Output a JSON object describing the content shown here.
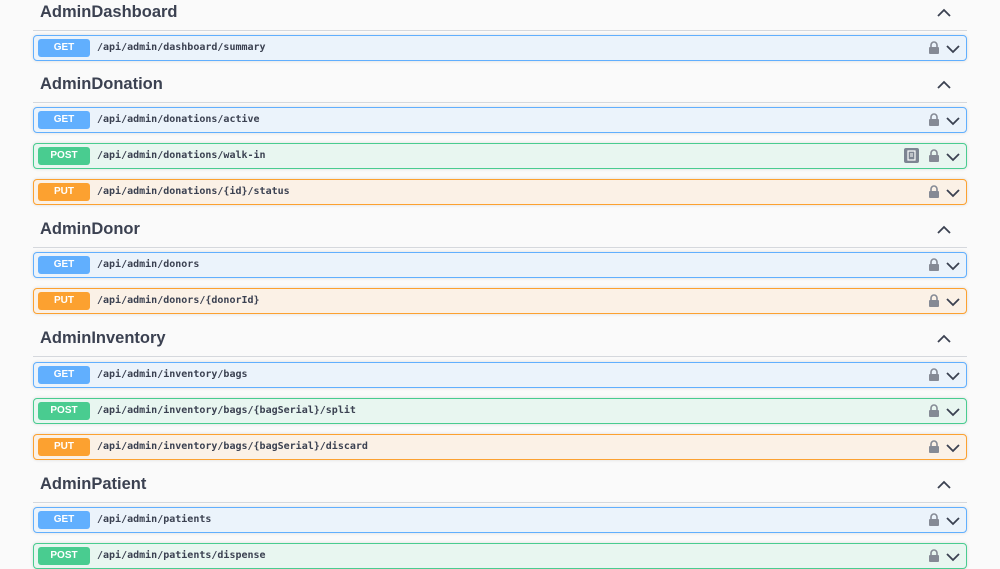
{
  "sections": [
    {
      "title": "AdminDashboard",
      "operations": [
        {
          "method": "GET",
          "path": "/api/admin/dashboard/summary"
        }
      ]
    },
    {
      "title": "AdminDonation",
      "operations": [
        {
          "method": "GET",
          "path": "/api/admin/donations/active"
        },
        {
          "method": "POST",
          "path": "/api/admin/donations/walk-in"
        },
        {
          "method": "PUT",
          "path": "/api/admin/donations/{id}/status"
        }
      ]
    },
    {
      "title": "AdminDonor",
      "operations": [
        {
          "method": "GET",
          "path": "/api/admin/donors"
        },
        {
          "method": "PUT",
          "path": "/api/admin/donors/{donorId}"
        }
      ]
    },
    {
      "title": "AdminInventory",
      "operations": [
        {
          "method": "GET",
          "path": "/api/admin/inventory/bags"
        },
        {
          "method": "POST",
          "path": "/api/admin/inventory/bags/{bagSerial}/split"
        },
        {
          "method": "PUT",
          "path": "/api/admin/inventory/bags/{bagSerial}/discard"
        }
      ]
    },
    {
      "title": "AdminPatient",
      "operations": [
        {
          "method": "GET",
          "path": "/api/admin/patients"
        },
        {
          "method": "POST",
          "path": "/api/admin/patients/dispense"
        }
      ]
    }
  ],
  "icons": {
    "lock": "lock-icon",
    "expand": "chevron-down-icon",
    "collapse": "chevron-up-icon",
    "copy": "copy-icon"
  },
  "colors": {
    "get": "#61affe",
    "post": "#49cc90",
    "put": "#fca130",
    "text": "#3b4151"
  }
}
